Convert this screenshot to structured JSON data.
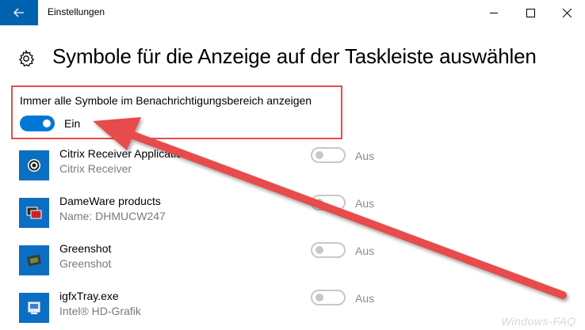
{
  "window": {
    "title": "Einstellungen",
    "back_icon": "arrow-left-icon",
    "controls": [
      "minimize-icon",
      "maximize-icon",
      "close-icon"
    ]
  },
  "header": {
    "icon": "gear-icon",
    "title": "Symbole für die Anzeige auf der Taskleiste auswählen"
  },
  "always_show": {
    "label": "Immer alle Symbole im Benachrichtigungsbereich anzeigen",
    "state": "Ein",
    "on": true
  },
  "apps": [
    {
      "name": "Citrix Receiver Application",
      "sub": "Citrix Receiver",
      "state": "Aus",
      "on": false,
      "icon": "citrix-receiver-icon"
    },
    {
      "name": "DameWare products",
      "sub": "Name: DHMUCW247",
      "state": "Aus",
      "on": false,
      "icon": "dameware-icon"
    },
    {
      "name": "Greenshot",
      "sub": "Greenshot",
      "state": "Aus",
      "on": false,
      "icon": "greenshot-icon"
    },
    {
      "name": "igfxTray.exe",
      "sub": "Intel® HD-Grafik",
      "state": "Aus",
      "on": false,
      "icon": "intel-graphics-icon"
    }
  ],
  "watermark": "Windows-FAQ",
  "colors": {
    "accent": "#0078d7",
    "back_button": "#0063b1",
    "annotation": "#e74c4c",
    "toggle_off": "#c8c8c8",
    "secondary_text": "#7a7a7a"
  }
}
